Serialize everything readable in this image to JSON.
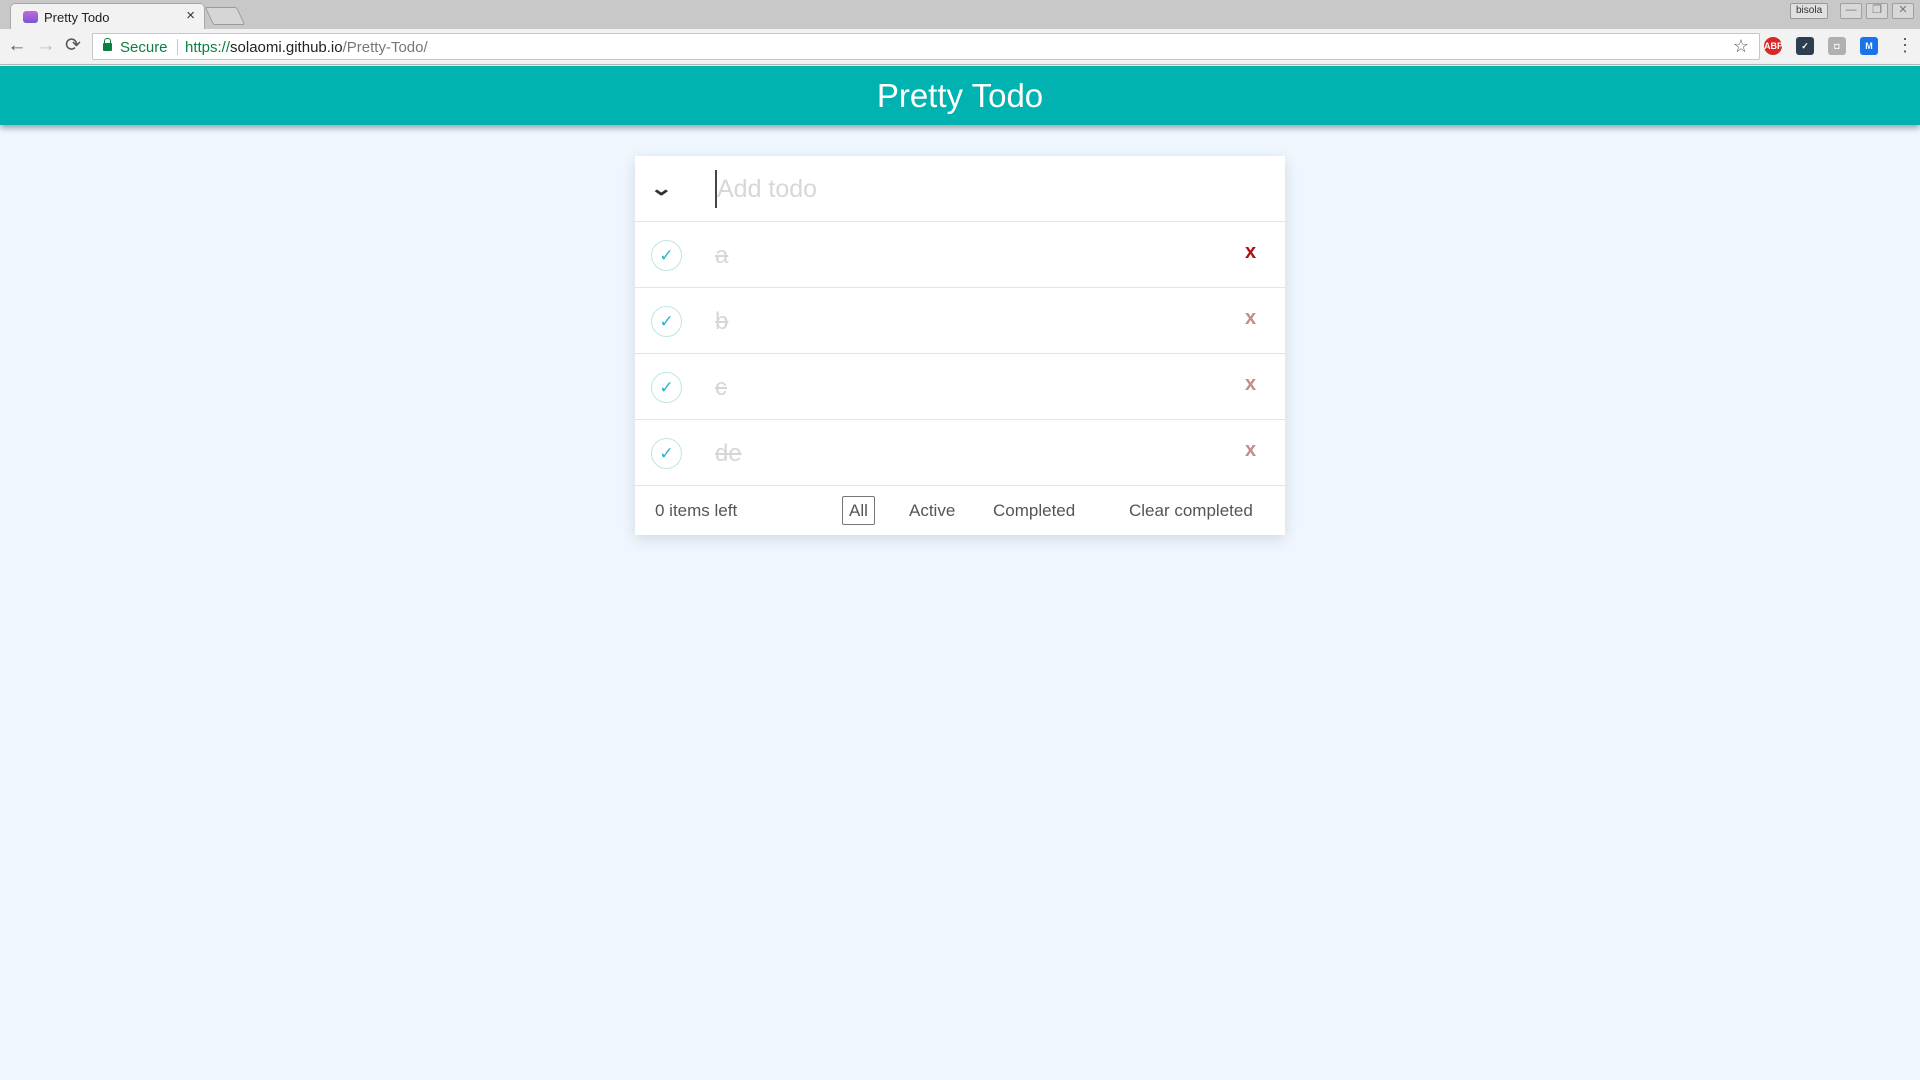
{
  "browser": {
    "tab_title": "Pretty Todo",
    "tab_close": "×",
    "secure_label": "Secure",
    "url_scheme": "https://",
    "url_host": "solaomi.github.io",
    "url_path": "/Pretty-Todo/",
    "user_chip": "bisola",
    "win_minimize": "—",
    "win_restore": "❐",
    "win_close": "✕",
    "back_icon": "←",
    "forward_icon": "→",
    "reload_icon": "⟳",
    "star_icon": "☆",
    "menu_icon": "⋮",
    "extensions": [
      {
        "name": "adblock-icon",
        "label": "ABP",
        "color": "#d62828"
      },
      {
        "name": "extension-icon",
        "label": "✓",
        "color": "#2d3e50"
      },
      {
        "name": "android-icon",
        "label": "◘",
        "color": "#b0b0b0"
      },
      {
        "name": "m-icon",
        "label": "M",
        "color": "#1a73e8"
      }
    ]
  },
  "app": {
    "title": "Pretty Todo",
    "input_placeholder": "Add todo",
    "toggle_all_icon": "⌄",
    "check_icon": "✓",
    "destroy_label": "x",
    "todos": [
      {
        "text": "a",
        "completed": true
      },
      {
        "text": "b",
        "completed": true
      },
      {
        "text": "c",
        "completed": true
      },
      {
        "text": "de",
        "completed": true
      }
    ],
    "footer": {
      "items_left": "0 items left",
      "filters": [
        "All",
        "Active",
        "Completed"
      ],
      "selected_filter": "All",
      "clear_completed": "Clear completed"
    }
  },
  "colors": {
    "header": "#00b3b0",
    "background": "#eff6fe",
    "check": "#29b5c9",
    "destroy": "#c58a8a",
    "destroy_hover": "#b01010"
  }
}
